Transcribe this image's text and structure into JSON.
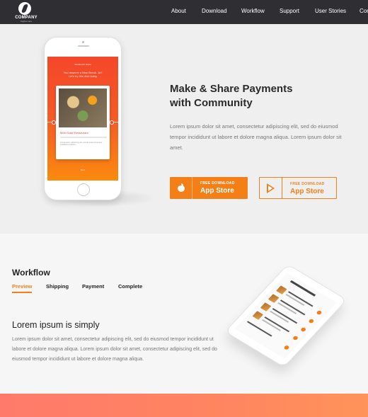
{
  "nav": {
    "logo_name": "COMPANY",
    "logo_tagline": "Tagline here",
    "items": [
      "About",
      "Download",
      "Workflow",
      "Support",
      "User Stories",
      "Con"
    ]
  },
  "hero": {
    "title_line1": "Make & Share Payments",
    "title_line2": "with Community",
    "text": "Lorem ipsum dolor sit amet, consectetur adipiscing elit, sed do eiusmod tempor incididunt ut labore et dolore magna aliqua. Lorem ipsum dolor sit amet.",
    "phone_screen": {
      "top": "Restaurant share",
      "headline1": "You deserve a Nice Break. Ja?",
      "headline2": "Let's try this dish today",
      "card_title": "Mobi Sake Restaurant",
      "card_text": "Consectetur, adipiscing elit, sed do eiusmod tempor incididunt ut labore.",
      "footer": "Next"
    },
    "buttons": [
      {
        "small": "FREE DOWNLOAD",
        "label": "App Store",
        "icon": "apple-icon"
      },
      {
        "small": "FREE DOWNLOAD",
        "label": "App Store",
        "icon": "play-icon"
      }
    ]
  },
  "workflow": {
    "title": "Workflow",
    "tabs": [
      "Preview",
      "Shipping",
      "Payment",
      "Complete"
    ],
    "active_tab": "Preview",
    "heading": "Lorem ipsum is simply",
    "text": "Lorem ipsum dolor sit amet, consectetur adipiscing elit, sed do eiusmod tempor incididunt ut labore et dolore magna aliqua. Lorem ipsum dolor sit amet, consectetur adipiscing elit, sed do eiusmod tempor incididunt ut labore et dolore magna aliqua."
  },
  "colors": {
    "accent": "#f57f17",
    "nav_bg": "#2e2e33",
    "hero_bg": "#efefef",
    "band": "#ff8560"
  }
}
